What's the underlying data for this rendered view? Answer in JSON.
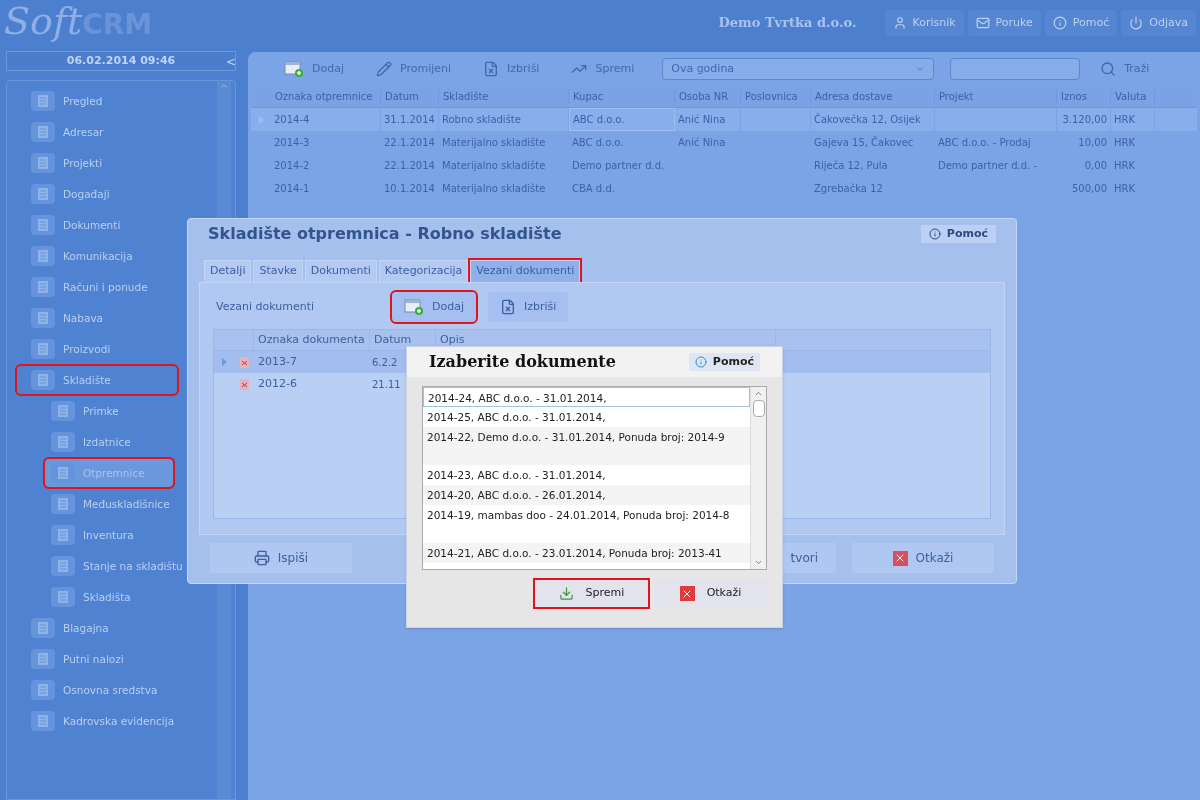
{
  "header": {
    "logo_soft": "Soft",
    "logo_crm": "CRM",
    "company": "Demo Tvrtka d.o.o.",
    "buttons": [
      {
        "label": "Korisnik"
      },
      {
        "label": "Poruke"
      },
      {
        "label": "Pomoć"
      },
      {
        "label": "Odjava"
      }
    ]
  },
  "sidebar": {
    "datetime": "06.02.2014 09:46",
    "collapse": "<",
    "items": [
      {
        "label": "Pregled",
        "selected": false,
        "highlighted": false
      },
      {
        "label": "Adresar",
        "selected": false,
        "highlighted": false
      },
      {
        "label": "Projekti",
        "selected": false,
        "highlighted": false
      },
      {
        "label": "Događaji",
        "selected": false,
        "highlighted": false
      },
      {
        "label": "Dokumenti",
        "selected": false,
        "highlighted": false
      },
      {
        "label": "Komunikacija",
        "selected": false,
        "highlighted": false
      },
      {
        "label": "Računi i ponude",
        "selected": false,
        "highlighted": false
      },
      {
        "label": "Nabava",
        "selected": false,
        "highlighted": false
      },
      {
        "label": "Proizvodi",
        "selected": false,
        "highlighted": false
      },
      {
        "label": "Skladište",
        "selected": false,
        "highlighted": true,
        "children": [
          {
            "label": "Primke",
            "selected": false,
            "highlighted": false
          },
          {
            "label": "Izdatnice",
            "selected": false,
            "highlighted": false
          },
          {
            "label": "Otpremnice",
            "selected": true,
            "highlighted": true
          },
          {
            "label": "Međuskladišnice",
            "selected": false,
            "highlighted": false
          },
          {
            "label": "Inventura",
            "selected": false,
            "highlighted": false
          },
          {
            "label": "Stanje na skladištu",
            "selected": false,
            "highlighted": false
          },
          {
            "label": "Skladišta",
            "selected": false,
            "highlighted": false
          }
        ]
      },
      {
        "label": "Blagajna",
        "selected": false,
        "highlighted": false
      },
      {
        "label": "Putni nalozi",
        "selected": false,
        "highlighted": false
      },
      {
        "label": "Osnovna sredstva",
        "selected": false,
        "highlighted": false
      },
      {
        "label": "Kadrovska evidencija",
        "selected": false,
        "highlighted": false
      }
    ]
  },
  "toolbar": {
    "buttons": [
      {
        "label": "Dodaj"
      },
      {
        "label": "Promijeni"
      },
      {
        "label": "Izbriši"
      },
      {
        "label": "Spremi"
      }
    ],
    "period": "Ova godina",
    "search_button": "Traži"
  },
  "table": {
    "columns": [
      "Oznaka otpremnice",
      "Datum",
      "Skladište",
      "Kupac",
      "Osoba NR",
      "Poslovnica",
      "Adresa dostave",
      "Projekt",
      "Iznos",
      "Valuta"
    ],
    "rows": [
      {
        "selected": true,
        "cells": [
          "2014-4",
          "31.1.2014",
          "Robno skladište",
          "ABC d.o.o.",
          "Anić Nina",
          "",
          "Čakovečka 12, Osijek",
          "",
          "3.120,00",
          "HRK"
        ]
      },
      {
        "selected": false,
        "cells": [
          "2014-3",
          "22.1.2014",
          "Materijalno skladište",
          "ABC d.o.o.",
          "Anić Nina",
          "",
          "Gajeva 15, Čakovec",
          "ABC d.o.o. - Prodaj",
          "10,00",
          "HRK"
        ]
      },
      {
        "selected": false,
        "cells": [
          "2014-2",
          "22.1.2014",
          "Materijalno skladište",
          "Demo partner d.d.",
          "",
          "",
          "Riječa 12, Pula",
          "Demo partner d.d. -",
          "0,00",
          "HRK"
        ]
      },
      {
        "selected": false,
        "cells": [
          "2014-1",
          "10.1.2014",
          "Materijalno skladište",
          "CBA d.d.",
          "",
          "",
          "Zgrebačka 12",
          "",
          "500,00",
          "HRK"
        ]
      }
    ]
  },
  "dialog": {
    "title": "Skladište otpremnica - Robno skladište",
    "help": "Pomoć",
    "tabs": [
      {
        "label": "Detalji",
        "selected": false,
        "highlighted": false
      },
      {
        "label": "Stavke",
        "selected": false,
        "highlighted": false
      },
      {
        "label": "Dokumenti",
        "selected": false,
        "highlighted": false
      },
      {
        "label": "Kategorizacija",
        "selected": false,
        "highlighted": false
      },
      {
        "label": "Vezani dokumenti",
        "selected": true,
        "highlighted": true
      }
    ],
    "section_label": "Vezani dokumenti",
    "buttons": [
      {
        "label": "Dodaj",
        "highlighted": true
      },
      {
        "label": "Izbriši",
        "highlighted": false
      }
    ],
    "columns": [
      "Oznaka dokumenta",
      "Datum",
      "Opis"
    ],
    "rows": [
      {
        "selected": true,
        "oznaka": "2013-7",
        "datum": "6.2.2"
      },
      {
        "selected": false,
        "oznaka": "2012-6",
        "datum": "21.11"
      }
    ],
    "footer_buttons": [
      {
        "label": "Ispiši"
      },
      {
        "label": "tvori"
      },
      {
        "label": "Otkaži"
      }
    ]
  },
  "picker": {
    "title": "Izaberite dokumente",
    "help": "Pomoć",
    "items": [
      {
        "text": "2014-24, ABC d.o.o. - 31.01.2014,",
        "selected": true,
        "kind": "short"
      },
      {
        "text": "2014-25, ABC d.o.o. - 31.01.2014,",
        "selected": false,
        "kind": "short"
      },
      {
        "text": "2014-22, Demo d.o.o. - 31.01.2014,  Ponuda broj: 2014-9",
        "selected": false,
        "kind": "tall"
      },
      {
        "text": "2014-23, ABC d.o.o. - 31.01.2014,",
        "selected": false,
        "kind": "short"
      },
      {
        "text": "2014-20, ABC d.o.o. - 26.01.2014,",
        "selected": false,
        "kind": "short"
      },
      {
        "text": "2014-19, mambas doo - 24.01.2014,  Ponuda broj: 2014-8",
        "selected": false,
        "kind": "tall"
      },
      {
        "text": "2014-21, ABC d.o.o. - 23.01.2014,  Ponuda broj: 2013-41",
        "selected": false,
        "kind": "short"
      }
    ],
    "buttons": [
      {
        "label": "Spremi",
        "highlighted": true
      },
      {
        "label": "Otkaži",
        "highlighted": false
      }
    ]
  }
}
